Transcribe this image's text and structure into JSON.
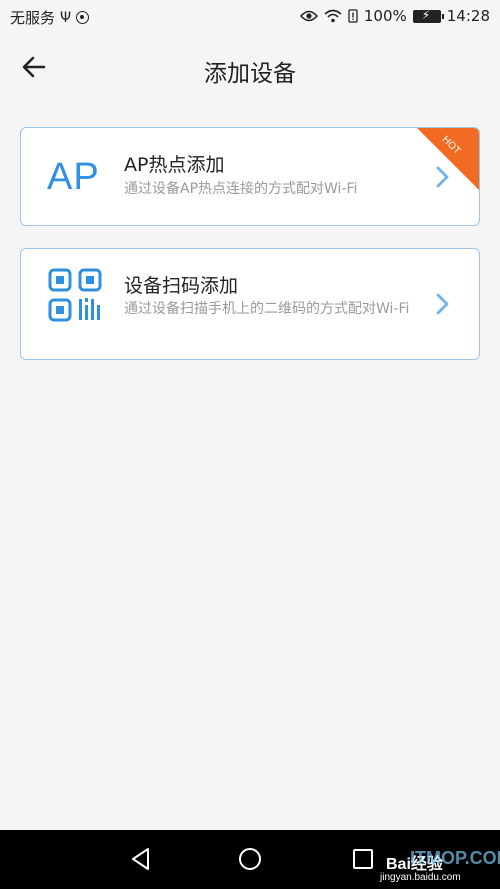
{
  "status_bar": {
    "carrier": "无服务",
    "usb_icon": "usb-icon",
    "battery_percent": "100%",
    "time": "14:28"
  },
  "header": {
    "title": "添加设备",
    "back_icon": "back-arrow-icon"
  },
  "cards": [
    {
      "icon_text": "AP",
      "title": "AP热点添加",
      "description": "通过设备AP热点连接的方式配对Wi-Fi",
      "badge": "HOT"
    },
    {
      "icon": "qr-code-icon",
      "title": "设备扫码添加",
      "description": "通过设备扫描手机上的二维码的方式配对Wi-Fi"
    }
  ],
  "watermark": {
    "main": "Bai经验",
    "sub": "jingyan.baidu.com",
    "overlay": "ITMOP.COM"
  },
  "colors": {
    "accent_blue": "#2f8fe0",
    "card_border": "#9cc6ef",
    "hot_orange": "#f26b22",
    "background": "#f5f5f5"
  }
}
